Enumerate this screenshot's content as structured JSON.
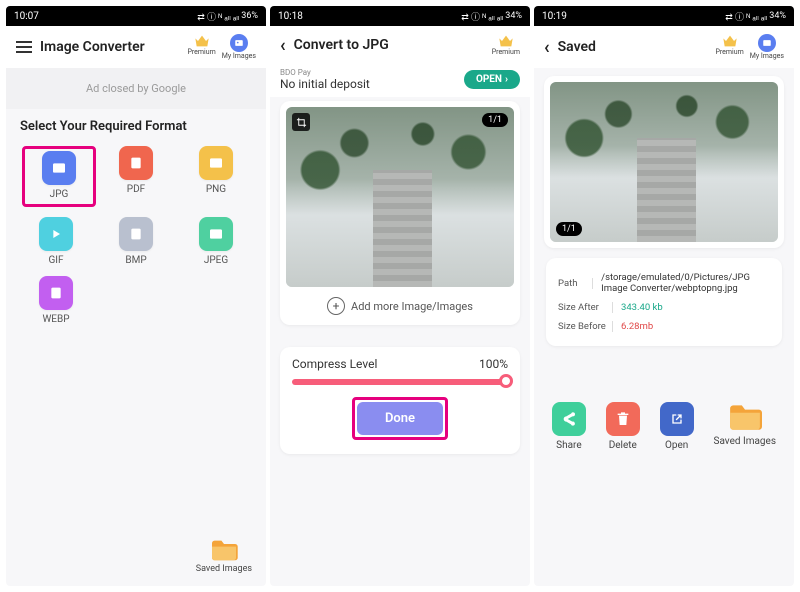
{
  "status": {
    "t1": "10:07",
    "t2": "10:18",
    "t3": "10:19",
    "icons": "⇄ ⓘ ᴺ ₐₗₗ ₐₗₗ",
    "bat1": "36%",
    "bat2": "34%",
    "bat3": "34%"
  },
  "s1": {
    "title": "Image Converter",
    "premium": "Premium",
    "myimages": "My Images",
    "ad": "Ad closed by Google",
    "section": "Select Your Required Format",
    "formats": [
      {
        "label": "JPG",
        "bg": "#5a7ef0",
        "glyph": "image"
      },
      {
        "label": "PDF",
        "bg": "#f0664e",
        "glyph": "doc"
      },
      {
        "label": "PNG",
        "bg": "#f4c14a",
        "glyph": "image"
      },
      {
        "label": "GIF",
        "bg": "#4fd0e0",
        "glyph": "play"
      },
      {
        "label": "BMP",
        "bg": "#b9c0cf",
        "glyph": "doc"
      },
      {
        "label": "JPEG",
        "bg": "#4fd0a0",
        "glyph": "image"
      },
      {
        "label": "WEBP",
        "bg": "#c25ff0",
        "glyph": "doc"
      }
    ],
    "saved": "Saved Images"
  },
  "s2": {
    "title": "Convert to JPG",
    "premium": "Premium",
    "bdo_small": "BDO Pay",
    "bdo": "No initial deposit",
    "open": "OPEN",
    "count": "1/1",
    "addmore": "Add more Image/Images",
    "compress_label": "Compress Level",
    "compress_val": "100%",
    "done": "Done"
  },
  "s3": {
    "title": "Saved",
    "premium": "Premium",
    "myimages": "My Images",
    "count": "1/1",
    "rows": {
      "path_k": "Path",
      "path_v": "/storage/emulated/0/Pictures/JPG Image Converter/webptopng.jpg",
      "after_k": "Size After",
      "after_v": "343.40 kb",
      "before_k": "Size Before",
      "before_v": "6.28mb"
    },
    "actions": {
      "share": "Share",
      "delete": "Delete",
      "open": "Open",
      "saved": "Saved Images"
    },
    "colors": {
      "share": "#3fcf9b",
      "delete": "#f26a5a",
      "open": "#4268c9"
    }
  }
}
